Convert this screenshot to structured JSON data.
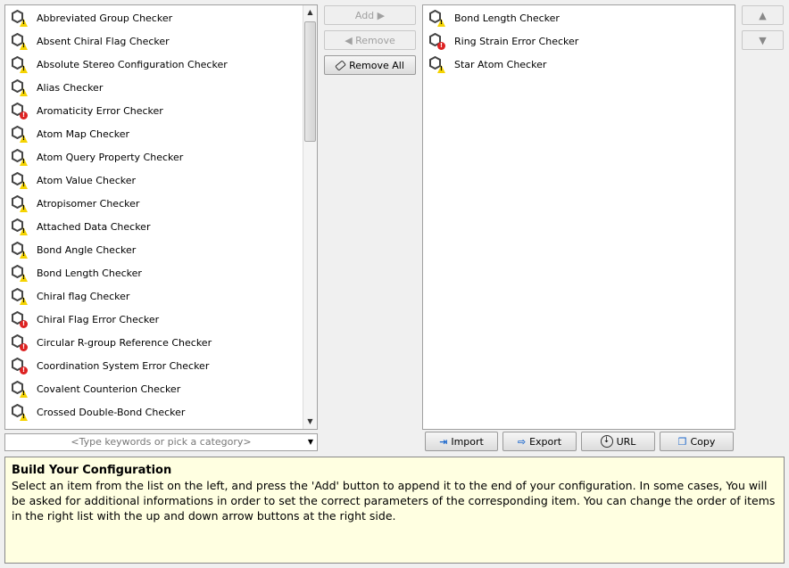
{
  "available": {
    "items": [
      {
        "label": "Abbreviated Group Checker",
        "severity": "warning"
      },
      {
        "label": "Absent Chiral Flag Checker",
        "severity": "warning"
      },
      {
        "label": "Absolute Stereo Configuration Checker",
        "severity": "warning"
      },
      {
        "label": "Alias Checker",
        "severity": "warning"
      },
      {
        "label": "Aromaticity Error Checker",
        "severity": "error"
      },
      {
        "label": "Atom Map Checker",
        "severity": "warning"
      },
      {
        "label": "Atom Query Property Checker",
        "severity": "warning"
      },
      {
        "label": "Atom Value Checker",
        "severity": "warning"
      },
      {
        "label": "Atropisomer Checker",
        "severity": "warning"
      },
      {
        "label": "Attached Data Checker",
        "severity": "warning"
      },
      {
        "label": "Bond Angle Checker",
        "severity": "warning"
      },
      {
        "label": "Bond Length Checker",
        "severity": "warning"
      },
      {
        "label": "Chiral flag Checker",
        "severity": "warning"
      },
      {
        "label": "Chiral Flag Error Checker",
        "severity": "error"
      },
      {
        "label": "Circular R-group Reference Checker",
        "severity": "error"
      },
      {
        "label": "Coordination System Error Checker",
        "severity": "error"
      },
      {
        "label": "Covalent Counterion Checker",
        "severity": "warning"
      },
      {
        "label": "Crossed Double-Bond Checker",
        "severity": "warning"
      }
    ],
    "search_placeholder": "<Type keywords or pick a category>"
  },
  "configuration": {
    "items": [
      {
        "label": "Bond Length Checker",
        "severity": "warning"
      },
      {
        "label": "Ring Strain Error Checker",
        "severity": "error"
      },
      {
        "label": "Star Atom Checker",
        "severity": "warning"
      }
    ]
  },
  "buttons": {
    "add": "Add ▶",
    "remove": "◀ Remove",
    "remove_all": "Remove All",
    "up": "▲",
    "down": "▼",
    "import": "Import",
    "export": "Export",
    "url": "URL",
    "copy": "Copy"
  },
  "help": {
    "title": "Build Your Configuration",
    "text": "Select an item from the list on the left, and press the 'Add' button to append it to the end of your configuration. In some cases, You will be asked for additional informations in order to set the correct parameters of the corresponding item. You can change the order of items in the right list with the up and down arrow buttons at the right side."
  }
}
